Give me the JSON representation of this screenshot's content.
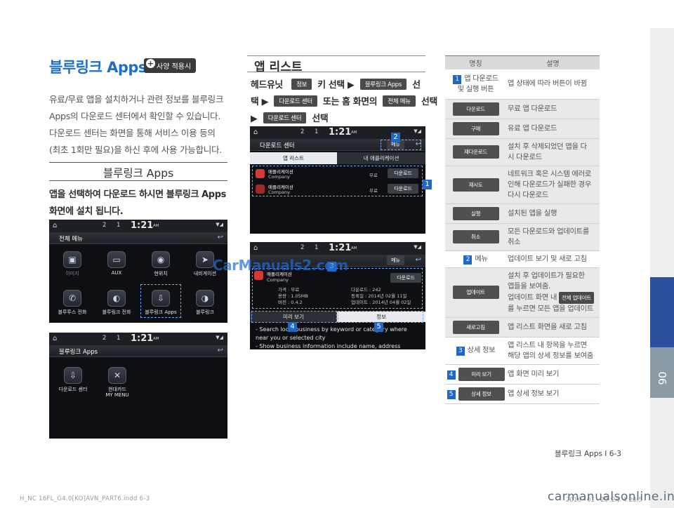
{
  "left": {
    "title": "블루링크 Apps",
    "model_badge": "사양 적용시",
    "intro": [
      "유료/무료 앱을 설치하거나 관련 정보를 블루링크",
      "Apps의 다운로드 센터에서 확인할 수 있습니다.",
      "다운로드 센터는 화면을 통해 서비스 이용 등의",
      "(최초 1회만 필요)을 하신 후에 사용 가능합니다."
    ],
    "subtitle": "블루링크 Apps",
    "instruction": [
      "앱을 선택하여 다운로드 하시면 블루링크 Apps",
      "화면에 설치 됩니다."
    ],
    "screen1": {
      "status_2": "2",
      "status_1": "1",
      "clock": "1:21",
      "am": "AM",
      "menu_title": "전체 메뉴",
      "apps": [
        "이미지",
        "AUX",
        "현위치",
        "내비게이션",
        "블루투스 전화",
        "블루링크 전화",
        "블루링크 Apps",
        "블루링크"
      ]
    },
    "screen2": {
      "status_2": "2",
      "status_1": "1",
      "clock": "1:21",
      "am": "AM",
      "menu_title": "블루링크 Apps",
      "apps": [
        "다운로드 센터",
        "현대카드",
        "MY MENU"
      ]
    }
  },
  "middle": {
    "title": "앱 리스트",
    "line1_a": "헤드유닛",
    "chip_info": "정보",
    "line1_b": "키 선택 ▶",
    "chip_apps": "블루링크 Apps",
    "line1_c": "선",
    "line2_a": "택 ▶",
    "chip_dl_center": "다운로드 센터",
    "line2_b": "또는 홈 화면의",
    "chip_all_menu": "전체 메뉴",
    "line2_c": "선택",
    "line3_a": "▶",
    "chip_dl_center2": "다운로드 센터",
    "line3_b": "선택",
    "screen3": {
      "status_2": "2",
      "status_1": "1",
      "clock": "1:21",
      "am": "AM",
      "menu_title": "다운로드 센터",
      "menu_btn": "메뉴",
      "tab_left": "앱 리스트",
      "tab_right": "내 애플리케이션",
      "rows": [
        {
          "name": "애플리케이션",
          "company": "Company",
          "price": "무료",
          "btn": "다운로드"
        },
        {
          "name": "애플리케이션",
          "company": "Company",
          "price": "무료",
          "btn": "다운로드"
        }
      ],
      "mark_1": "1",
      "mark_2": "2"
    },
    "screen4": {
      "status_2": "2",
      "status_1": "1",
      "clock": "1:21",
      "am": "AM",
      "menu_btn": "메뉴",
      "app_name": "애플리케이션",
      "company": "Company",
      "btn": "다운로드",
      "detail_left": [
        "가격 : 무료",
        "용량 : 1.05MB",
        "버전 : 0.4.2"
      ],
      "detail_right": [
        "다운로드 : 242",
        "등록일 : 2014년 02월 11일",
        "업데이트 : 2014년 04월 02일"
      ],
      "tab_preview": "미리 보기",
      "tab_info": "정보",
      "desc": [
        "- Search local business by keyword or category where",
        "near you or selected city",
        "- Show business information include name, address"
      ],
      "mark_3": "3",
      "mark_4": "4",
      "mark_5": "5"
    },
    "watermark": "CarManuals2.com"
  },
  "table": {
    "header_name": "명칭",
    "header_desc": "설명",
    "rows": [
      {
        "num": "1",
        "name": "앱 다운로드",
        "name2": "및 실행 버튼",
        "desc": [
          "앱 상태에 따라 버튼이 바뀜"
        ],
        "grey": false
      },
      {
        "chip": "다운로드",
        "desc": [
          "무료 앱 다운로드"
        ],
        "grey": true
      },
      {
        "chip": "구매",
        "desc": [
          "유료 앱 다운로드"
        ],
        "grey": true
      },
      {
        "chip": "재다운로드",
        "desc": [
          "설치 후 삭제되었던 앱을 다",
          "시 다운로드"
        ],
        "grey": true
      },
      {
        "chip": "재시도",
        "desc": [
          "네트워크 혹은 시스템 에러로",
          "인해 다운로드가 실패한 경우",
          "다시 다운로드"
        ],
        "grey": true
      },
      {
        "chip": "실행",
        "desc": [
          "설치된 앱을 실행"
        ],
        "grey": true
      },
      {
        "chip": "취소",
        "desc": [
          "모든 다운로드와 업데이트를",
          "취소"
        ],
        "grey": true
      },
      {
        "num": "2",
        "name": "메뉴",
        "desc": [
          "업데이트 보기 및 새로 고침"
        ],
        "grey": false
      },
      {
        "chip": "업데이트",
        "desc": [
          "설치 후 업데이트가 필요한",
          "앱들을 보여줌.",
          "업데이트 화면 내"
        ],
        "desc_chip": "전체 업데이트",
        "desc_tail": "를 누르면 모든 앱을 업데이트",
        "grey": true
      },
      {
        "chip": "새로고침",
        "desc": [
          "앱 리스트 화면을 새로 고침"
        ],
        "grey": true
      },
      {
        "num": "3",
        "name": "상세 정보",
        "desc": [
          "앱 리스트 내 항목을 누르면",
          "해당 앱의 상세 정보를 보여줌"
        ],
        "grey": false
      },
      {
        "num": "4",
        "chip": "미리 보기",
        "desc": [
          "앱 화면 미리 보기"
        ],
        "grey": false
      },
      {
        "num": "5",
        "chip": "상세 정보",
        "desc": [
          "앱 상세 정보 보기"
        ],
        "grey": false
      }
    ]
  },
  "side_tab": "06",
  "footer": "블루링크 Apps I 6-3",
  "print_left": "H_NC 16FL_G4.0[KO]AVN_PART6.indd   6-3",
  "print_right": "2016 - 01 - 29   오후 4:20:5",
  "site_mark": "carmanualsonline.info"
}
